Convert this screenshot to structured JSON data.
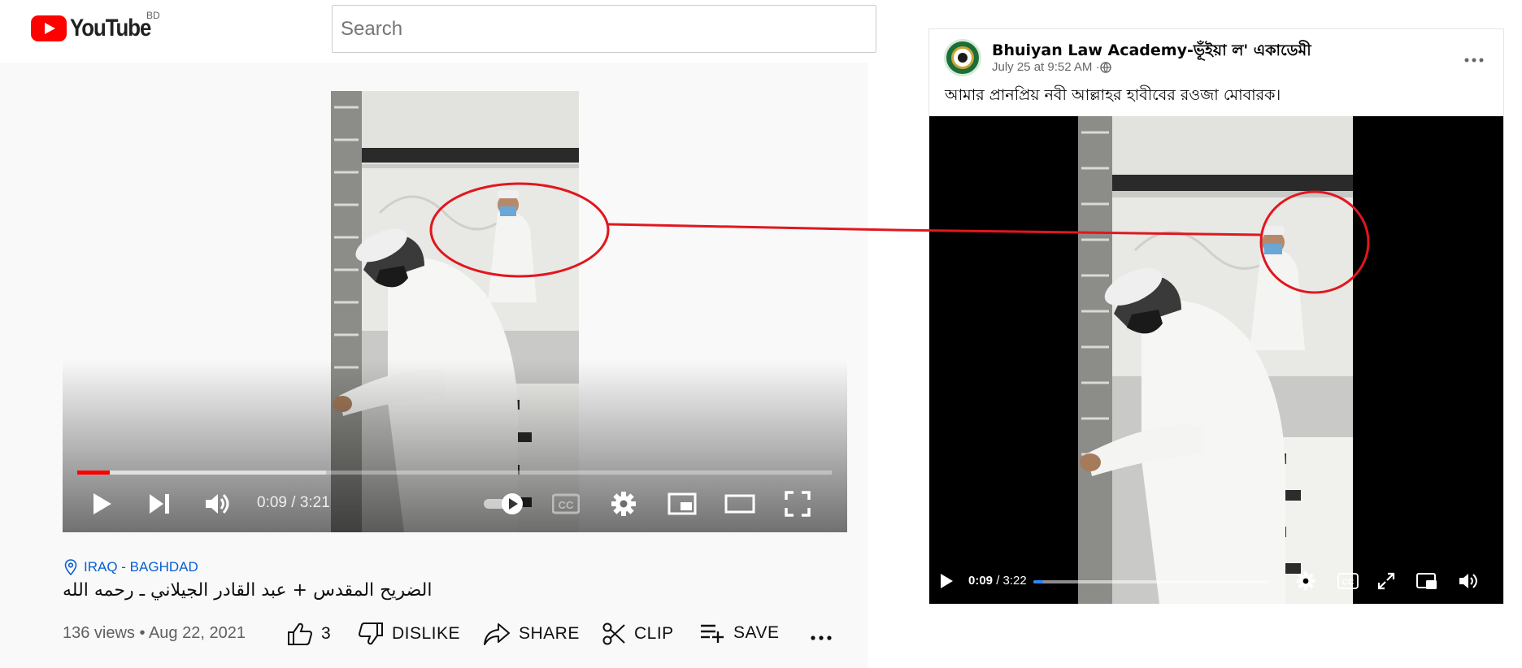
{
  "youtube": {
    "logo_text": "YouTube",
    "country_code": "BD",
    "search_placeholder": "Search",
    "player": {
      "time_display": "0:09 / 3:21",
      "progress_fraction": 0.043,
      "buffer_fraction": 0.33,
      "controls": [
        "play-icon",
        "next-icon",
        "volume-icon",
        "autoplay-toggle",
        "cc-icon",
        "settings-icon",
        "miniplayer-icon",
        "theater-icon",
        "fullscreen-icon"
      ]
    },
    "location": "IRAQ - BAGHDAD",
    "title": "الضريح المقدس + عبد القادر الجيلاني ـ رحمه الله",
    "meta": "136 views • Aug 22, 2021",
    "actions": {
      "likes": "3",
      "dislike": "DISLIKE",
      "share": "SHARE",
      "clip": "CLIP",
      "save": "SAVE"
    },
    "colors": {
      "brand_red": "#ff0000",
      "link_blue": "#065fd4"
    }
  },
  "facebook": {
    "page_name": "Bhuiyan Law Academy-ভূঁইয়া ল' একাডেমী",
    "post_date": "July 25 at 9:52 AM · ",
    "privacy_icon": "globe-icon",
    "caption": "আমার প্রানপ্রিয় নবী আল্লাহর হাবীবের রওজা মোবারক।",
    "player": {
      "time_current": "0:09",
      "time_separator": " / ",
      "time_total": "3:22",
      "progress_fraction": 0.04,
      "controls": [
        "play-icon",
        "settings-icon",
        "cc-icon",
        "expand-icon",
        "pip-icon",
        "volume-icon"
      ]
    },
    "colors": {
      "progress_blue": "#2d88ff"
    }
  },
  "annotation": {
    "highlight_color": "#e0171f"
  }
}
